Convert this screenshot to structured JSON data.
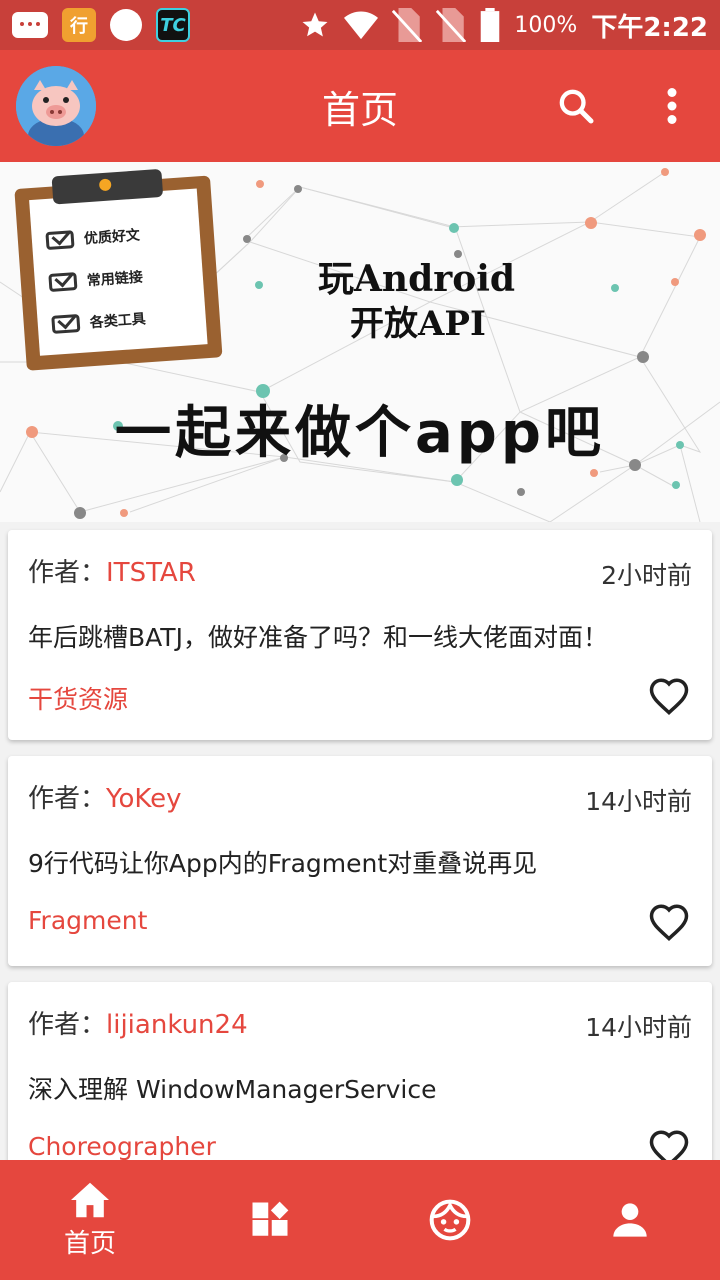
{
  "status_bar": {
    "notif_badge": "行",
    "tc_badge": "TC",
    "battery": "100%",
    "time": "下午2:22"
  },
  "app_bar": {
    "title": "首页"
  },
  "banner": {
    "clipboard_items": [
      "优质好文",
      "常用链接",
      "各类工具"
    ],
    "title_line1": "玩Android",
    "title_line2": "开放API",
    "slogan": "一起来做个app吧"
  },
  "articles": [
    {
      "author_label": "作者：",
      "author": "ITSTAR",
      "time": "2小时前",
      "title": "年后跳槽BATJ，做好准备了吗？和一线大佬面对面！",
      "tag": "干货资源"
    },
    {
      "author_label": "作者：",
      "author": "YoKey",
      "time": "14小时前",
      "title": "9行代码让你App内的Fragment对重叠说再见",
      "tag": "Fragment"
    },
    {
      "author_label": "作者：",
      "author": "lijiankun24",
      "time": "14小时前",
      "title": "深入理解 WindowManagerService",
      "tag": "Choreographer"
    }
  ],
  "bottom_nav": {
    "home_label": "首页"
  },
  "colors": {
    "primary": "#e5473e",
    "status_bar": "#c8403a"
  }
}
